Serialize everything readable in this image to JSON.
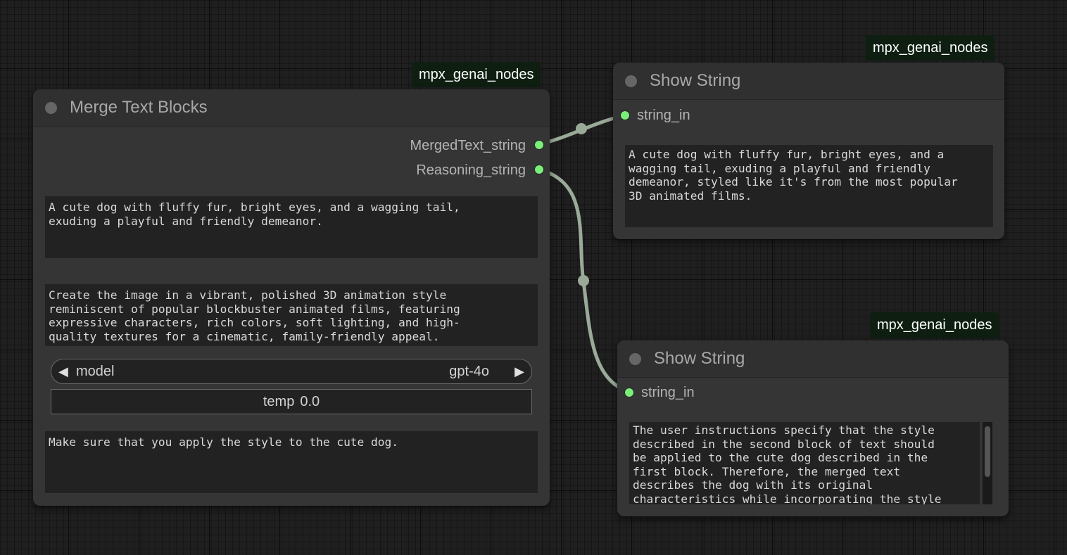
{
  "merge_node": {
    "badge": "mpx_genai_nodes",
    "title": "Merge Text Blocks",
    "outputs": [
      "MergedText_string",
      "Reasoning_string"
    ],
    "text_block_1": "A cute dog with fluffy fur, bright eyes, and a wagging tail,\nexuding a playful and friendly demeanor.",
    "text_block_2": "Create the image in a vibrant, polished 3D animation style\nreminiscent of popular blockbuster animated films, featuring\nexpressive characters, rich colors, soft lighting, and high-\nquality textures for a cinematic, family-friendly appeal.",
    "model": {
      "label": "model",
      "value": "gpt-4o"
    },
    "temp": {
      "label": "temp",
      "value": "0.0"
    },
    "instructions": "Make sure that you apply the style to the cute dog."
  },
  "show_string_1": {
    "badge": "mpx_genai_nodes",
    "title": "Show String",
    "input": "string_in",
    "text": "A cute dog with fluffy fur, bright eyes, and a\nwagging tail, exuding a playful and friendly\ndemeanor, styled like it's from the most popular\n3D animated films."
  },
  "show_string_2": {
    "badge": "mpx_genai_nodes",
    "title": "Show String",
    "input": "string_in",
    "text": "The user instructions specify that the style\ndescribed in the second block of text should\nbe applied to the cute dog described in the\nfirst block. Therefore, the merged text\ndescribes the dog with its original\ncharacteristics while incorporating the style"
  },
  "colors": {
    "canvas": "#1f1f1f",
    "node_body": "#353535",
    "node_header": "#303030",
    "slot_dot": "#7af07a",
    "link": "#9aaa98",
    "badge_bg": "#0e1f11"
  }
}
